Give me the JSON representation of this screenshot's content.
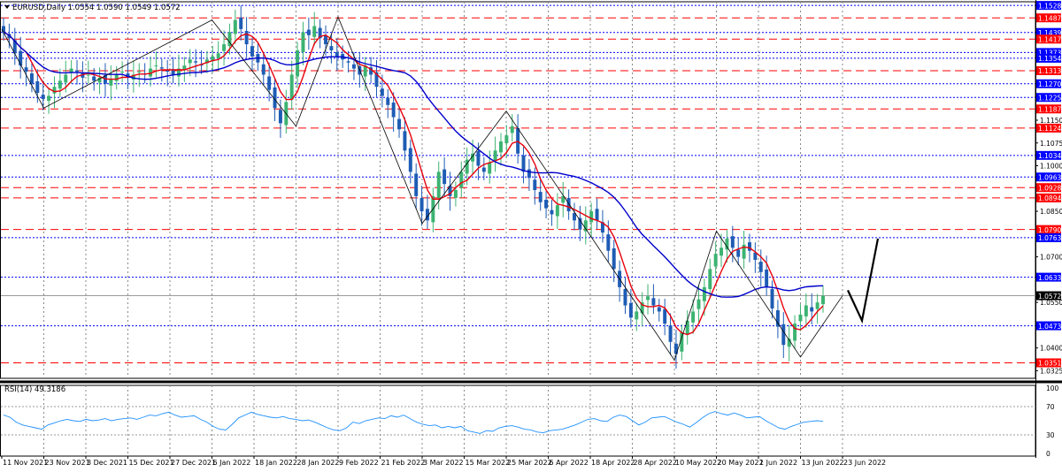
{
  "header": {
    "symbol_line": "EURUSD,Daily  1.0554 1.0590 1.0549 1.0572",
    "menu_icon": "triangle-down-icon"
  },
  "rsi": {
    "label": "RSI(14) 49.3186",
    "levels": [
      "70",
      "30"
    ],
    "scale_top": "100",
    "scale_bottom": "0",
    "color": "#1e90ff"
  },
  "colors": {
    "bull": "#3cb371",
    "bear": "#1e5cb4",
    "ma_fast": "#e8000b",
    "ma_slow": "#0000cc",
    "level_red": "#ff0000",
    "level_blue": "#0000ff",
    "zigzag": "#000000",
    "projection": "#000000"
  },
  "chart_data": {
    "type": "candlestick",
    "instrument": "EURUSD",
    "timeframe": "Daily",
    "ylim": [
      1.03,
      1.154
    ],
    "x_date_labels": [
      "11 Nov 2021",
      "23 Nov 2021",
      "3 Dec 2021",
      "15 Dec 2021",
      "27 Dec 2021",
      "6 Jan 2022",
      "18 Jan 2022",
      "28 Jan 2022",
      "9 Feb 2022",
      "21 Feb 2022",
      "3 Mar 2022",
      "15 Mar 2022",
      "25 Mar 2022",
      "6 Apr 2022",
      "18 Apr 2022",
      "28 Apr 2022",
      "10 May 2022",
      "20 May 2022",
      "1 Jun 2022",
      "13 Jun 2022",
      "23 Jun 2022"
    ],
    "y_ticks": [
      "1.1150",
      "1.1075",
      "1.1000",
      "1.0850",
      "1.0700",
      "1.0550",
      "1.0400",
      "1.0325"
    ],
    "price_levels": [
      {
        "value": 1.1528,
        "label": "1.1528",
        "color": "blue",
        "style": "dotted"
      },
      {
        "value": 1.1487,
        "label": "1.1487",
        "color": "red",
        "style": "dashed"
      },
      {
        "value": 1.1439,
        "label": "1.1439",
        "color": "blue",
        "style": "dotted"
      },
      {
        "value": 1.1417,
        "label": "1.1417",
        "color": "red",
        "style": "dashed"
      },
      {
        "value": 1.1373,
        "label": "1.1373",
        "color": "blue",
        "style": "dotted"
      },
      {
        "value": 1.1354,
        "label": "1.1354",
        "color": "blue",
        "style": "dotted"
      },
      {
        "value": 1.1313,
        "label": "1.1313",
        "color": "red",
        "style": "dashed"
      },
      {
        "value": 1.127,
        "label": "1.1270",
        "color": "blue",
        "style": "dotted"
      },
      {
        "value": 1.1225,
        "label": "1.1225",
        "color": "blue",
        "style": "dotted"
      },
      {
        "value": 1.1187,
        "label": "1.1187",
        "color": "red",
        "style": "dashed"
      },
      {
        "value": 1.1124,
        "label": "1.1124",
        "color": "red",
        "style": "dashed"
      },
      {
        "value": 1.1034,
        "label": "1.1034",
        "color": "blue",
        "style": "dotted"
      },
      {
        "value": 1.0963,
        "label": "1.0963",
        "color": "blue",
        "style": "dotted"
      },
      {
        "value": 1.0928,
        "label": "1.0928",
        "color": "red",
        "style": "dashed"
      },
      {
        "value": 1.0894,
        "label": "1.0894",
        "color": "red",
        "style": "dashed"
      },
      {
        "value": 1.079,
        "label": "1.0790",
        "color": "red",
        "style": "dashed"
      },
      {
        "value": 1.0763,
        "label": "1.0763",
        "color": "blue",
        "style": "dotted"
      },
      {
        "value": 1.0633,
        "label": "1.0633",
        "color": "blue",
        "style": "dotted"
      },
      {
        "value": 1.0473,
        "label": "1.0473",
        "color": "blue",
        "style": "dotted"
      },
      {
        "value": 1.0351,
        "label": "1.0351",
        "color": "red",
        "style": "dashed"
      }
    ],
    "current_price": {
      "value": 1.0572,
      "label": "1.0572"
    },
    "candles_close": [
      1.144,
      1.142,
      1.137,
      1.133,
      1.131,
      1.127,
      1.124,
      1.122,
      1.123,
      1.126,
      1.128,
      1.13,
      1.132,
      1.131,
      1.129,
      1.13,
      1.128,
      1.129,
      1.127,
      1.1285,
      1.13,
      1.131,
      1.129,
      1.13,
      1.131,
      1.13,
      1.132,
      1.133,
      1.132,
      1.131,
      1.13,
      1.132,
      1.133,
      1.135,
      1.134,
      1.133,
      1.135,
      1.136,
      1.137,
      1.14,
      1.144,
      1.148,
      1.145,
      1.14,
      1.136,
      1.134,
      1.13,
      1.125,
      1.119,
      1.114,
      1.121,
      1.13,
      1.138,
      1.144,
      1.143,
      1.146,
      1.142,
      1.14,
      1.138,
      1.136,
      1.135,
      1.134,
      1.132,
      1.13,
      1.133,
      1.13,
      1.126,
      1.123,
      1.12,
      1.116,
      1.112,
      1.105,
      1.098,
      1.09,
      1.085,
      1.082,
      1.09,
      1.098,
      1.094,
      1.09,
      1.092,
      1.098,
      1.102,
      1.104,
      1.1,
      1.098,
      1.101,
      1.105,
      1.108,
      1.11,
      1.113,
      1.104,
      1.098,
      1.096,
      1.092,
      1.088,
      1.086,
      1.084,
      1.087,
      1.09,
      1.085,
      1.082,
      1.079,
      1.082,
      1.085,
      1.082,
      1.078,
      1.072,
      1.066,
      1.06,
      1.054,
      1.05,
      1.052,
      1.055,
      1.057,
      1.054,
      1.052,
      1.048,
      1.042,
      1.038,
      1.045,
      1.049,
      1.052,
      1.056,
      1.06,
      1.066,
      1.071,
      1.073,
      1.076,
      1.073,
      1.07,
      1.074,
      1.072,
      1.069,
      1.065,
      1.06,
      1.053,
      1.047,
      1.041,
      1.043,
      1.048,
      1.051,
      1.054,
      1.052,
      1.055,
      1.0572
    ],
    "zigzag_points": [
      {
        "date": "11 Nov 2021",
        "price": 1.145
      },
      {
        "date": "23 Nov 2021",
        "price": 1.119
      },
      {
        "date": "6 Jan 2022",
        "price": 1.148
      },
      {
        "date": "28 Jan 2022",
        "price": 1.113
      },
      {
        "date": "9 Feb 2022",
        "price": 1.149
      },
      {
        "date": "3 Mar 2022",
        "price": 1.081
      },
      {
        "date": "25 Mar 2022",
        "price": 1.118
      },
      {
        "date": "10 May 2022",
        "price": 1.036
      },
      {
        "date": "20 May 2022",
        "price": 1.0785
      },
      {
        "date": "13 Jun 2022",
        "price": 1.037
      },
      {
        "date": "23 Jun 2022",
        "price": 1.0572
      }
    ],
    "projection_points": [
      {
        "date": "23 Jun 2022",
        "price": 1.059
      },
      {
        "price": 1.049
      },
      {
        "price": 1.076
      }
    ],
    "rsi_values": [
      58,
      55,
      48,
      44,
      42,
      40,
      38,
      44,
      47,
      50,
      52,
      50,
      49,
      52,
      50,
      51,
      53,
      50,
      52,
      53,
      54,
      52,
      55,
      58,
      57,
      60,
      62,
      58,
      55,
      56,
      57,
      52,
      48,
      42,
      38,
      37,
      45,
      54,
      58,
      62,
      59,
      57,
      55,
      54,
      56,
      53,
      52,
      50,
      51,
      48,
      44,
      40,
      37,
      36,
      40,
      48,
      46,
      50,
      52,
      54,
      53,
      57,
      55,
      58,
      53,
      48,
      45,
      43,
      44,
      40,
      42,
      40,
      42,
      36,
      34,
      32,
      36,
      35,
      40,
      42,
      43,
      41,
      38,
      37,
      34,
      33,
      36,
      37,
      38,
      41,
      44,
      48,
      52,
      53,
      50,
      49,
      55,
      58,
      56,
      50,
      44,
      48,
      54,
      55,
      56,
      52,
      48,
      45,
      41,
      47,
      54,
      60,
      63,
      60,
      58,
      61,
      58,
      54,
      55,
      56,
      50,
      45,
      40,
      38,
      42,
      45,
      48,
      49,
      50,
      49.3
    ]
  }
}
